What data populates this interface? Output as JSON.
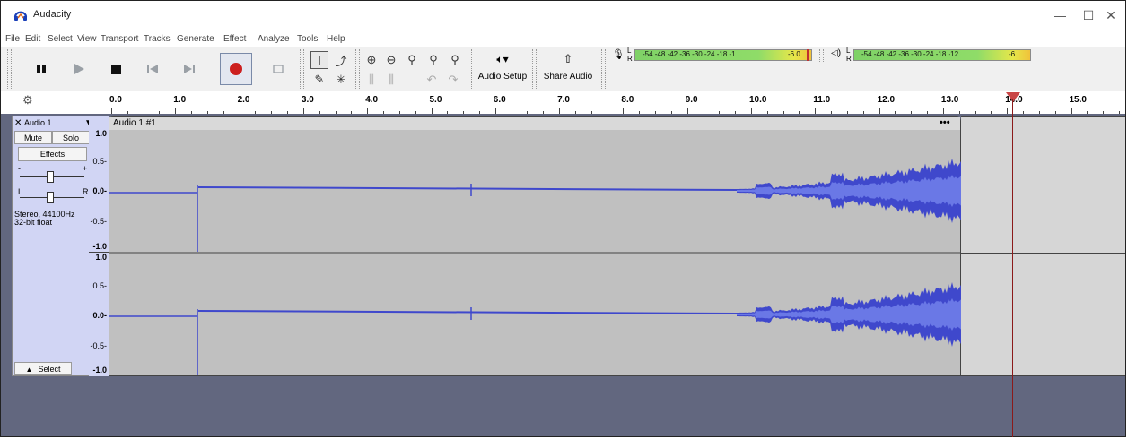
{
  "window": {
    "title": "Audacity",
    "minimize": "—",
    "maximize": "☐",
    "close": "✕"
  },
  "menu": [
    "File",
    "Edit",
    "Select",
    "View",
    "Transport",
    "Tracks",
    "Generate",
    "Effect",
    "Analyze",
    "Tools",
    "Help"
  ],
  "toolbar": {
    "audio_setup": "Audio Setup",
    "share_audio": "Share Audio",
    "meter_scale": "-54  -48  -42  -36  -30  -24  -18  -12  -6  0",
    "rec_meter_scale": "-54 -48 -42 -36 -30 -24 -18 -1",
    "rec_meter_end": "-6  0",
    "play_meter_scale": "-54  -48  -42  -36  -30  -24  -18  -12",
    "play_meter_end": "-6",
    "channel_L": "L",
    "channel_R": "R"
  },
  "ruler": {
    "ticks": [
      "0.0",
      "1.0",
      "2.0",
      "3.0",
      "4.0",
      "5.0",
      "6.0",
      "7.0",
      "8.0",
      "9.0",
      "10.0",
      "11.0",
      "12.0",
      "13.0",
      "14.0",
      "15.0"
    ],
    "playhead_seconds": 14.0
  },
  "track": {
    "name": "Audio 1",
    "mute": "Mute",
    "solo": "Solo",
    "effects": "Effects",
    "gain_minus": "-",
    "gain_plus": "+",
    "pan_left": "L",
    "pan_right": "R",
    "format_line1": "Stereo, 44100Hz",
    "format_line2": "32-bit float",
    "select": "Select",
    "clip_name": "Audio 1 #1",
    "clip_menu": "•••",
    "vscale_top": [
      "1.0",
      "0.5-",
      "0.0-",
      "-0.5-",
      "-1.0"
    ],
    "vscale_bottom": [
      "1.0",
      "0.5-",
      "0.0-",
      "-0.5-",
      "-1.0"
    ]
  },
  "colors": {
    "waveform": "#3f48cc",
    "waveform_rms": "#6a78e6",
    "clip_bg": "#c0c0c0",
    "track_panel": "#d1d5f4",
    "background": "#62677f",
    "record": "#cc1f1f"
  }
}
